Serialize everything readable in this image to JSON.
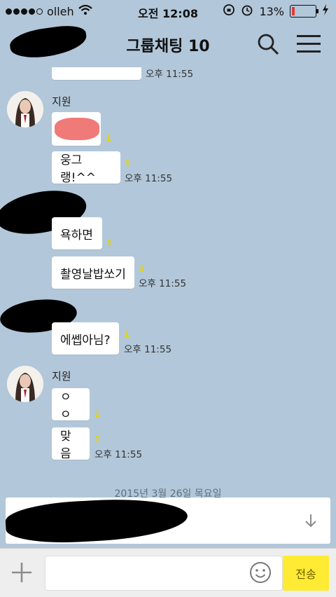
{
  "status": {
    "carrier": "olleh",
    "time": "오전 12:08",
    "battery": "13%",
    "battery_fraction": 0.13
  },
  "nav": {
    "title": "그룹채팅",
    "member_count": "10",
    "icons": [
      "search-icon",
      "menu-icon"
    ]
  },
  "messages": [
    {
      "text": "",
      "time": "오후 11:55"
    },
    {
      "sender": "지원",
      "text": "",
      "unread": "1"
    },
    {
      "text": "웅그랭!^^",
      "unread": "1",
      "time": "오후 11:55"
    },
    {
      "text": "욕하면",
      "unread": "1"
    },
    {
      "text": "촬영날밥쏘기",
      "unread": "1",
      "time": "오후 11:55"
    },
    {
      "text": "에쎕아님?",
      "unread": "1",
      "time": "오후 11:55"
    },
    {
      "sender": "지원",
      "text": "ㅇㅇ",
      "unread": "1"
    },
    {
      "text": "맞음",
      "unread": "1",
      "time": "오후 11:55"
    }
  ],
  "date_separator": "2015년 3월 26일 목요일",
  "input": {
    "send_label": "전송"
  },
  "colors": {
    "chat_background": "#b2c7d9",
    "send_button": "#ffeb33",
    "unread": "#e6d400"
  }
}
